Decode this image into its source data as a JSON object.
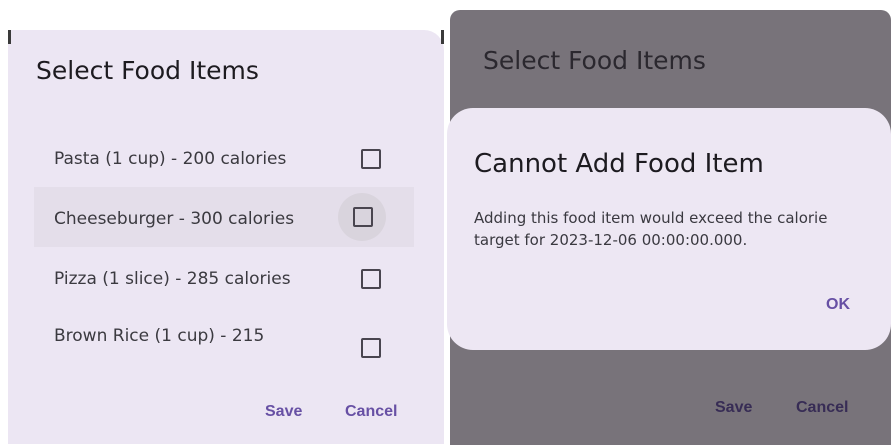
{
  "left": {
    "title": "Select Food Items",
    "items": [
      {
        "label": "Pasta (1 cup) - 200 calories",
        "checked": false
      },
      {
        "label": "Cheeseburger - 300 calories",
        "checked": false
      },
      {
        "label": "Pizza (1 slice) - 285 calories",
        "checked": false
      },
      {
        "label": "Brown Rice (1 cup) - 215",
        "checked": false
      }
    ],
    "save_label": "Save",
    "cancel_label": "Cancel"
  },
  "right": {
    "title": "Select Food Items",
    "save_label": "Save",
    "cancel_label": "Cancel",
    "dialog": {
      "title": "Cannot Add Food Item",
      "body": "Adding this food item would exceed the calorie target for 2023-12-06 00:00:00.000.",
      "ok_label": "OK"
    }
  },
  "colors": {
    "surface": "#ECE6F3",
    "accent": "#6750A4",
    "scrim": "#78737A"
  }
}
